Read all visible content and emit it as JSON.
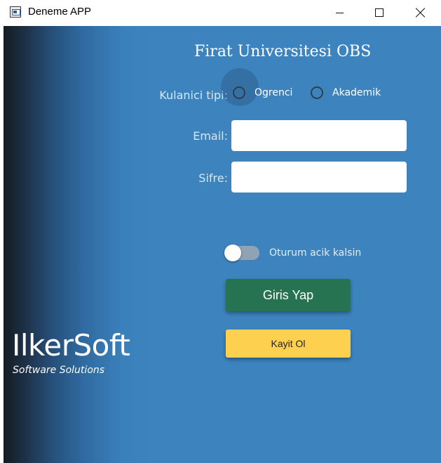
{
  "window": {
    "title": "Deneme APP",
    "icon": "app-window-icon",
    "controls": [
      "minimize-icon",
      "maximize-icon",
      "close-icon"
    ]
  },
  "form": {
    "title": "Firat Universitesi OBS",
    "user_type_label": "Kulanici tipi:",
    "user_type_options": [
      "Ogrenci",
      "Akademik"
    ],
    "email_label": "Email:",
    "email_value": "",
    "password_label": "Sifre:",
    "password_value": "",
    "remember_label": "Oturum acik kalsin",
    "remember_on": false,
    "login_button": "Giris Yap",
    "register_button": "Kayit Ol"
  },
  "branding": {
    "name": "IlkerSoft",
    "tagline": "Software Solutions"
  },
  "colors": {
    "background_blue": "#3d84bf",
    "login_button": "#257351",
    "register_button": "#fdd04f"
  }
}
